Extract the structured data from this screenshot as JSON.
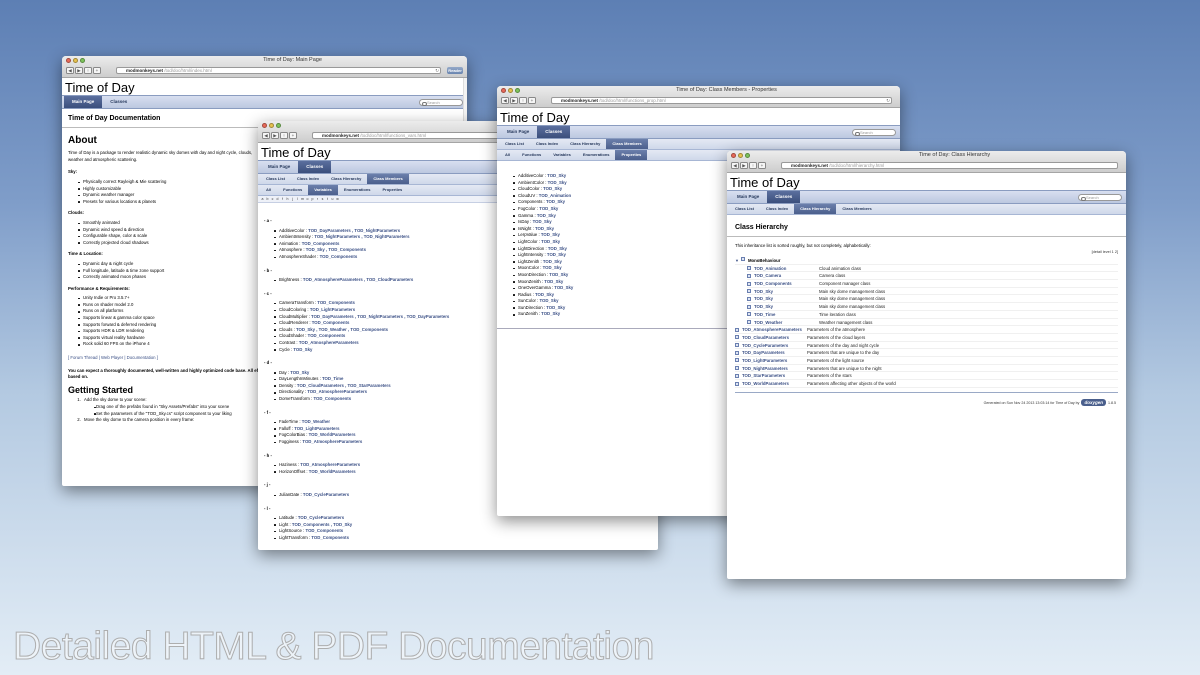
{
  "caption": "Detailed HTML & PDF Documentation",
  "windows": [
    {
      "id": "main",
      "title": "Time of Day: Main Page",
      "url_domain": "modmonkeys.net",
      "url_path": "/tod/doc/html/index.html",
      "reader_label": "Reader",
      "site_title": "Time of Day",
      "tabs": [
        "Main Page",
        "Classes"
      ],
      "search_placeholder": "Search",
      "page_heading": "Time of Day Documentation",
      "about_heading": "About",
      "about_text": "Time of Day is a package to render realistic dynamic sky domes with day and night cycle, clouds, weather and atmospheric scattering.",
      "sections": [
        {
          "label": "Sky:",
          "items": [
            "Physically correct Rayleigh & Mie scattering",
            "Highly customizable",
            "Dynamic weather manager",
            "Presets for various locations & planets"
          ]
        },
        {
          "label": "Clouds:",
          "items": [
            "Smoothly animated",
            "Dynamic wind speed & direction",
            "Configurable shape, color & scale",
            "Correctly projected cloud shadows"
          ]
        },
        {
          "label": "Time & Location:",
          "items": [
            "Dynamic day & night cycle",
            "Full longitude, latitude & time zone support",
            "Correctly animated moon phases"
          ]
        },
        {
          "label": "Performance & Requirements:",
          "items": [
            "Unity Indie or Pro 3.5.7+",
            "Runs on shader model 2.0",
            "Runs on all platforms",
            "Supports linear & gamma color space",
            "Supports forward & deferred rendering",
            "Supports HDR & LDR rendering",
            "Supports virtual reality hardware",
            "Rock solid 60 FPS on the iPhone 4"
          ]
        }
      ],
      "links_line": "[ Forum Thread | Web Player | Documentation ]",
      "closing_text": "You can expect a thoroughly documented, well-written and highly optimized code base. All effects are physically based on.",
      "getting_started_heading": "Getting Started",
      "steps": [
        {
          "text": "Add the sky dome to your scene:",
          "sub": [
            "Drag one of the prefabs found in \"Sky Assets/Prefabs\" into your scene",
            "Set the parameters of the \"TOD_Sky.cs\" script component to your liking"
          ]
        },
        {
          "text": "Move the sky dome to the camera position in every frame:",
          "sub": []
        }
      ]
    },
    {
      "id": "variables",
      "title": "Time of Day: Class Members - Variables",
      "url_domain": "modmonkeys.net",
      "url_path": "/tod/doc/html/functions_vars.html",
      "site_title": "Time of Day",
      "tabs": [
        "Main Page",
        "Classes"
      ],
      "subtabs": [
        "Class List",
        "Class Index",
        "Class Hierarchy",
        "Class Members"
      ],
      "subtabs2": [
        "All",
        "Functions",
        "Variables",
        "Enumerations",
        "Properties"
      ],
      "alpha": [
        "a",
        "b",
        "c",
        "d",
        "f",
        "h",
        "j",
        "l",
        "m",
        "o",
        "p",
        "r",
        "s",
        "t",
        "u",
        "w"
      ],
      "search_placeholder": "Search",
      "groups": [
        {
          "letter": "- a -",
          "items": [
            [
              "AdditiveColor : ",
              "TOD_DayParameters , TOD_NightParameters"
            ],
            [
              "AmbientIntensity : ",
              "TOD_NightParameters , TOD_NightParameters"
            ],
            [
              "Animation : ",
              "TOD_Components"
            ],
            [
              "Atmosphere : ",
              "TOD_Sky , TOD_Components"
            ],
            [
              "AtmosphereShader : ",
              "TOD_Components"
            ]
          ]
        },
        {
          "letter": "- b -",
          "items": [
            [
              "Brightness : ",
              "TOD_AtmosphereParameters , TOD_CloudParameters"
            ]
          ]
        },
        {
          "letter": "- c -",
          "items": [
            [
              "CameraTransform : ",
              "TOD_Components"
            ],
            [
              "CloudColoring : ",
              "TOD_LightParameters"
            ],
            [
              "CloudMultiplier : ",
              "TOD_DayParameters , TOD_NightParameters , TOD_DayParameters"
            ],
            [
              "CloudRenderer : ",
              "TOD_Components"
            ],
            [
              "Clouds : ",
              "TOD_Sky , TOD_Weather , TOD_Components"
            ],
            [
              "CloudShader : ",
              "TOD_Components"
            ],
            [
              "Contrast : ",
              "TOD_AtmosphereParameters"
            ],
            [
              "Cycle : ",
              "TOD_Sky"
            ]
          ]
        },
        {
          "letter": "- d -",
          "items": [
            [
              "Day : ",
              "TOD_Sky"
            ],
            [
              "DayLengthInMinutes : ",
              "TOD_Time"
            ],
            [
              "Density : ",
              "TOD_CloudParameters , TOD_StarParameters"
            ],
            [
              "Directionality : ",
              "TOD_AtmosphereParameters"
            ],
            [
              "DomeTransform : ",
              "TOD_Components"
            ]
          ]
        },
        {
          "letter": "- f -",
          "items": [
            [
              "FadeTime : ",
              "TOD_Weather"
            ],
            [
              "Falloff : ",
              "TOD_LightParameters"
            ],
            [
              "FogColorBias : ",
              "TOD_WorldParameters"
            ],
            [
              "Fogginess : ",
              "TOD_AtmosphereParameters"
            ]
          ]
        },
        {
          "letter": "- h -",
          "items": [
            [
              "Haziness : ",
              "TOD_AtmosphereParameters"
            ],
            [
              "HorizonOffset : ",
              "TOD_WorldParameters"
            ]
          ]
        },
        {
          "letter": "- j -",
          "items": [
            [
              "JulianDate : ",
              "TOD_CycleParameters"
            ]
          ]
        },
        {
          "letter": "- l -",
          "items": [
            [
              "Latitude : ",
              "TOD_CycleParameters"
            ],
            [
              "Light : ",
              "TOD_Components , TOD_Sky"
            ],
            [
              "LightSource : ",
              "TOD_Components"
            ],
            [
              "LightTransform : ",
              "TOD_Components"
            ]
          ]
        }
      ]
    },
    {
      "id": "properties",
      "title": "Time of Day: Class Members - Properties",
      "url_domain": "modmonkeys.net",
      "url_path": "/tod/doc/html/functions_prop.html",
      "site_title": "Time of Day",
      "tabs": [
        "Main Page",
        "Classes"
      ],
      "subtabs": [
        "Class List",
        "Class Index",
        "Class Hierarchy",
        "Class Members"
      ],
      "subtabs2": [
        "All",
        "Functions",
        "Variables",
        "Enumerations",
        "Properties"
      ],
      "search_placeholder": "Search",
      "items": [
        [
          "AdditiveColor : ",
          "TOD_Sky"
        ],
        [
          "AmbientColor : ",
          "TOD_Sky"
        ],
        [
          "CloudColor : ",
          "TOD_Sky"
        ],
        [
          "CloudUV : ",
          "TOD_Animation"
        ],
        [
          "Components : ",
          "TOD_Sky"
        ],
        [
          "FogColor : ",
          "TOD_Sky"
        ],
        [
          "Gamma : ",
          "TOD_Sky"
        ],
        [
          "IsDay : ",
          "TOD_Sky"
        ],
        [
          "IsNight : ",
          "TOD_Sky"
        ],
        [
          "LerpValue : ",
          "TOD_Sky"
        ],
        [
          "LightColor : ",
          "TOD_Sky"
        ],
        [
          "LightDirection : ",
          "TOD_Sky"
        ],
        [
          "LightIntensity : ",
          "TOD_Sky"
        ],
        [
          "LightZenith : ",
          "TOD_Sky"
        ],
        [
          "MoonColor : ",
          "TOD_Sky"
        ],
        [
          "MoonDirection : ",
          "TOD_Sky"
        ],
        [
          "MoonZenith : ",
          "TOD_Sky"
        ],
        [
          "OneOverGamma : ",
          "TOD_Sky"
        ],
        [
          "Radius : ",
          "TOD_Sky"
        ],
        [
          "SunColor : ",
          "TOD_Sky"
        ],
        [
          "SunDirection : ",
          "TOD_Sky"
        ],
        [
          "SunZenith : ",
          "TOD_Sky"
        ]
      ]
    },
    {
      "id": "hierarchy",
      "title": "Time of Day: Class Hierarchy",
      "url_domain": "modmonkeys.net",
      "url_path": "/tod/doc/html/hierarchy.html",
      "site_title": "Time of Day",
      "tabs": [
        "Main Page",
        "Classes"
      ],
      "subtabs": [
        "Class List",
        "Class Index",
        "Class Hierarchy",
        "Class Members"
      ],
      "search_placeholder": "Search",
      "heading": "Class Hierarchy",
      "intro": "This inheritance list is sorted roughly, but not completely, alphabetically:",
      "detail_level": "[detail level 1 2]",
      "root": "MonoBehaviour",
      "children": [
        [
          "TOD_Animation",
          "Cloud animation class"
        ],
        [
          "TOD_Camera",
          "Camera class"
        ],
        [
          "TOD_Components",
          "Component manager class"
        ],
        [
          "TOD_Sky",
          "Main sky dome management class"
        ],
        [
          "TOD_Sky",
          "Main sky dome management class"
        ],
        [
          "TOD_Sky",
          "Main sky dome management class"
        ],
        [
          "TOD_Time",
          "Time iteration class"
        ],
        [
          "TOD_Weather",
          "Weather management class"
        ]
      ],
      "others": [
        [
          "TOD_AtmosphereParameters",
          "Parameters of the atmosphere"
        ],
        [
          "TOD_CloudParameters",
          "Parameters of the cloud layers"
        ],
        [
          "TOD_CycleParameters",
          "Parameters of the day and night cycle"
        ],
        [
          "TOD_DayParameters",
          "Parameters that are unique to the day"
        ],
        [
          "TOD_LightParameters",
          "Parameters of the light source"
        ],
        [
          "TOD_NightParameters",
          "Parameters that are unique to the night"
        ],
        [
          "TOD_StarParameters",
          "Parameters of the stars"
        ],
        [
          "TOD_WorldParameters",
          "Parameters affecting other objects of the world"
        ]
      ],
      "footer": "Generated on Sun Nov 24 2013 13:03:14 for Time of Day by",
      "footer_logo": "doxygen",
      "footer_version": "1.8.5"
    }
  ]
}
